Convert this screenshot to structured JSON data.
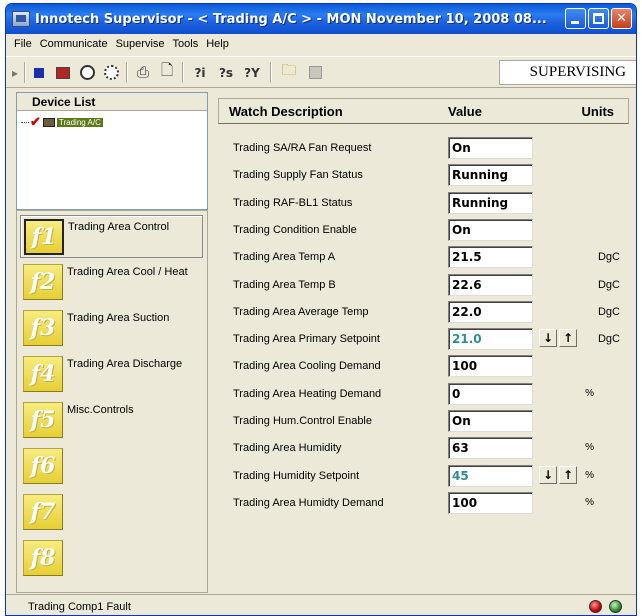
{
  "window": {
    "title": "Innotech Supervisor - < Trading A/C > - MON November 10, 2008 08..."
  },
  "menu": [
    "File",
    "Communicate",
    "Supervise",
    "Tools",
    "Help"
  ],
  "toolbar": {
    "mode_label": "SUPERVISING",
    "buttons": [
      "play-icon",
      "stop-icon",
      "record-icon",
      "clock-icon",
      "gauge-icon",
      "printer-icon",
      "print-preview-icon",
      "info-icon",
      "schedule-icon",
      "trend-icon",
      "open-folder-icon",
      "save-icon"
    ],
    "text_buttons": [
      "?i",
      "?s",
      "?Y"
    ]
  },
  "device_list": {
    "title": "Device List",
    "items": [
      {
        "label": "Trading A/C",
        "checked": true
      }
    ]
  },
  "function_keys": [
    {
      "key": "f1",
      "label": "Trading Area Control",
      "selected": true
    },
    {
      "key": "f2",
      "label": "Trading Area Cool / Heat",
      "selected": false
    },
    {
      "key": "f3",
      "label": "Trading Area Suction",
      "selected": false
    },
    {
      "key": "f4",
      "label": "Trading Area Discharge",
      "selected": false
    },
    {
      "key": "f5",
      "label": "Misc.Controls",
      "selected": false
    },
    {
      "key": "f6",
      "label": "",
      "selected": false
    },
    {
      "key": "f7",
      "label": "",
      "selected": false
    },
    {
      "key": "f8",
      "label": "",
      "selected": false
    }
  ],
  "watch": {
    "header": {
      "description": "Watch Description",
      "value": "Value",
      "units": "Units"
    },
    "rows": [
      {
        "description": "Trading SA/RA Fan Request",
        "value": "On",
        "units": "",
        "setpoint": false
      },
      {
        "description": "Trading Supply Fan Status",
        "value": "Running",
        "units": "",
        "setpoint": false
      },
      {
        "description": "Trading RAF-BL1 Status",
        "value": "Running",
        "units": "",
        "setpoint": false
      },
      {
        "description": "Trading Condition Enable",
        "value": "On",
        "units": "",
        "setpoint": false
      },
      {
        "description": "Trading Area Temp A",
        "value": "21.5",
        "units": "DgC",
        "setpoint": false
      },
      {
        "description": "Trading Area Temp B",
        "value": "22.6",
        "units": "DgC",
        "setpoint": false
      },
      {
        "description": "Trading Area Average Temp",
        "value": "22.0",
        "units": "DgC",
        "setpoint": false
      },
      {
        "description": "Trading Area Primary Setpoint",
        "value": "21.0",
        "units": "DgC",
        "setpoint": true
      },
      {
        "description": "Trading Area Cooling Demand",
        "value": "100",
        "units": "",
        "setpoint": false
      },
      {
        "description": "Trading Area Heating Demand",
        "value": "0",
        "units": "%",
        "setpoint": false
      },
      {
        "description": "Trading Hum.Control Enable",
        "value": "On",
        "units": "",
        "setpoint": false
      },
      {
        "description": "Trading Area Humidity",
        "value": "63",
        "units": "%",
        "setpoint": false
      },
      {
        "description": "Trading Humidity Setpoint",
        "value": "45",
        "units": "%",
        "setpoint": true
      },
      {
        "description": "Trading Area Humidty Demand",
        "value": "100",
        "units": "%",
        "setpoint": false
      }
    ]
  },
  "status": {
    "message": "Trading Comp1 Fault",
    "indicators": [
      {
        "name": "alarm-led",
        "color": "#c40000"
      },
      {
        "name": "comms-led",
        "color": "#2e8b2e"
      }
    ]
  }
}
